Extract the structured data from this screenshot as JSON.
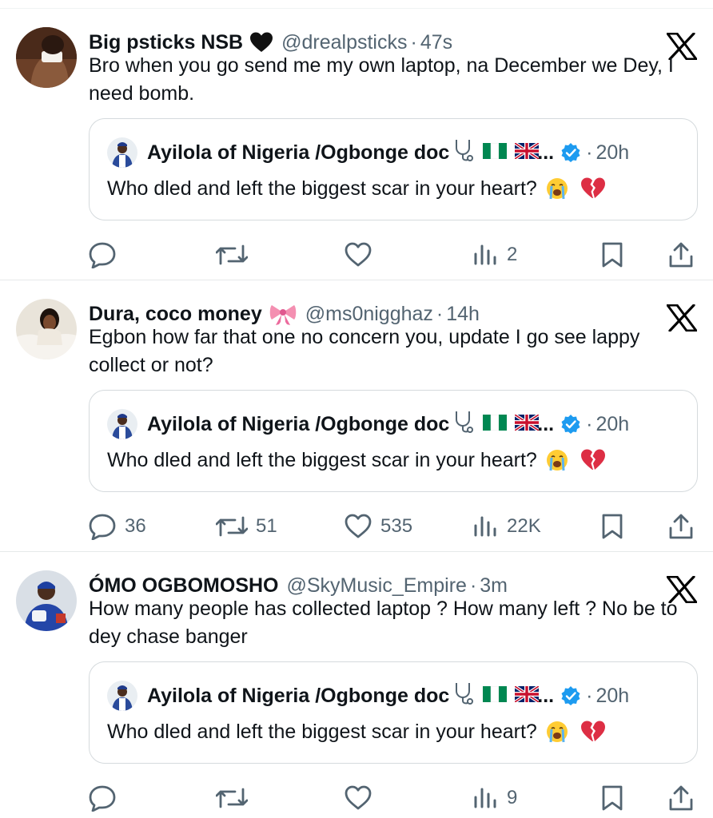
{
  "tweets": [
    {
      "display_name": "Big psticks NSB",
      "name_emoji": "black-heart",
      "handle": "@drealpsticks",
      "separator": "·",
      "time": "47s",
      "text": "Bro when you go send me my own laptop, na December we Dey,  I need bomb.",
      "metrics": {
        "replies": "",
        "reposts": "",
        "likes": "",
        "views": "2"
      }
    },
    {
      "display_name": "Dura, coco money",
      "name_emoji": "ribbon",
      "handle": "@ms0nigghaz",
      "separator": "·",
      "time": "14h",
      "text": "Egbon how far that one no concern you, update I go see lappy collect or not?",
      "metrics": {
        "replies": "36",
        "reposts": "51",
        "likes": "535",
        "views": "22K"
      }
    },
    {
      "display_name": "ÓMO OGBOMOSHO",
      "name_emoji": "",
      "handle": "@SkyMusic_Empire",
      "separator": "·",
      "time": "3m",
      "text": "How many people has collected laptop ? How many left ? No be to dey chase banger",
      "metrics": {
        "replies": "",
        "reposts": "",
        "likes": "",
        "views": "9"
      }
    }
  ],
  "quoted": {
    "name": "Ayilola of Nigeria /Ogbonge doc",
    "name_icons": [
      "stethoscope-icon",
      "nigeria-flag-icon",
      "uk-flag-icon"
    ],
    "ellipsis": "...",
    "verified": true,
    "separator": "·",
    "time": "20h",
    "text": "Who dled and left the biggest scar in your heart?",
    "text_emojis": [
      "loudly-crying-face",
      "broken-heart"
    ]
  },
  "colors": {
    "text_primary": "#0f1419",
    "text_secondary": "#536471",
    "verified_blue": "#1d9bf0",
    "border": "#d5dadd"
  }
}
